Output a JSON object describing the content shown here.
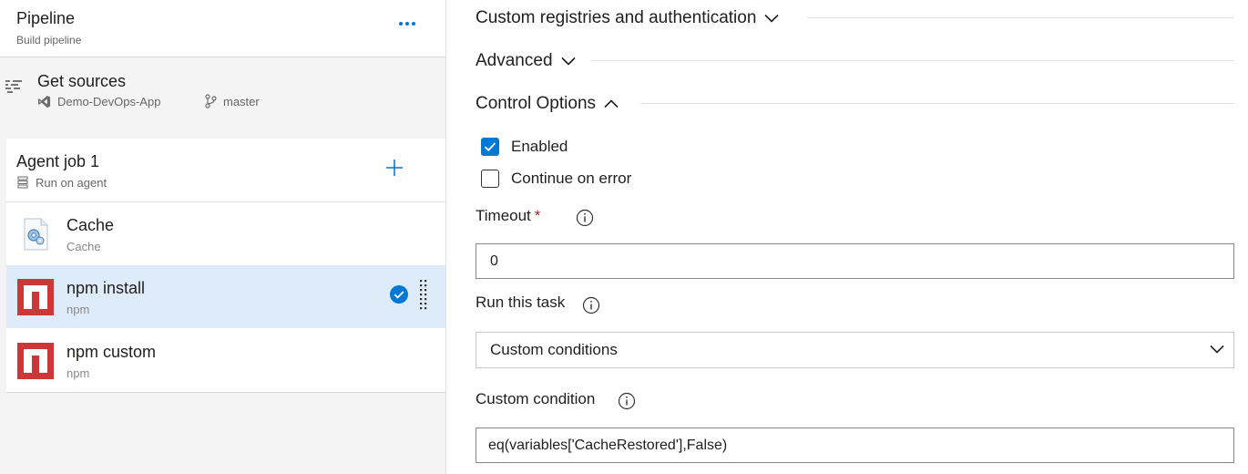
{
  "pipeline": {
    "title": "Pipeline",
    "subtitle": "Build pipeline",
    "more_icon": "more-horizontal-icon"
  },
  "sources": {
    "title": "Get sources",
    "repo": "Demo-DevOps-App",
    "branch": "master"
  },
  "job": {
    "title": "Agent job 1",
    "subtitle": "Run on agent"
  },
  "tasks": [
    {
      "title": "Cache",
      "subtitle": "Cache",
      "icon": "cache-task-icon",
      "selected": false
    },
    {
      "title": "npm install",
      "subtitle": "npm",
      "icon": "npm-icon",
      "selected": true
    },
    {
      "title": "npm custom",
      "subtitle": "npm",
      "icon": "npm-icon",
      "selected": false
    }
  ],
  "sections": {
    "custom_registries": "Custom registries and authentication",
    "advanced": "Advanced",
    "control_options": "Control Options"
  },
  "control_options": {
    "enabled_label": "Enabled",
    "enabled_checked": true,
    "continue_label": "Continue on error",
    "continue_checked": false,
    "timeout_label": "Timeout",
    "timeout_required_mark": "*",
    "timeout_value": "0",
    "run_label": "Run this task",
    "run_value": "Custom conditions",
    "condition_label": "Custom condition",
    "condition_value": "eq(variables['CacheRestored'],False)"
  },
  "colors": {
    "accent": "#0078d4",
    "npm_red": "#cb3837",
    "selected_bg": "#deecf9",
    "required": "#a4262c"
  }
}
